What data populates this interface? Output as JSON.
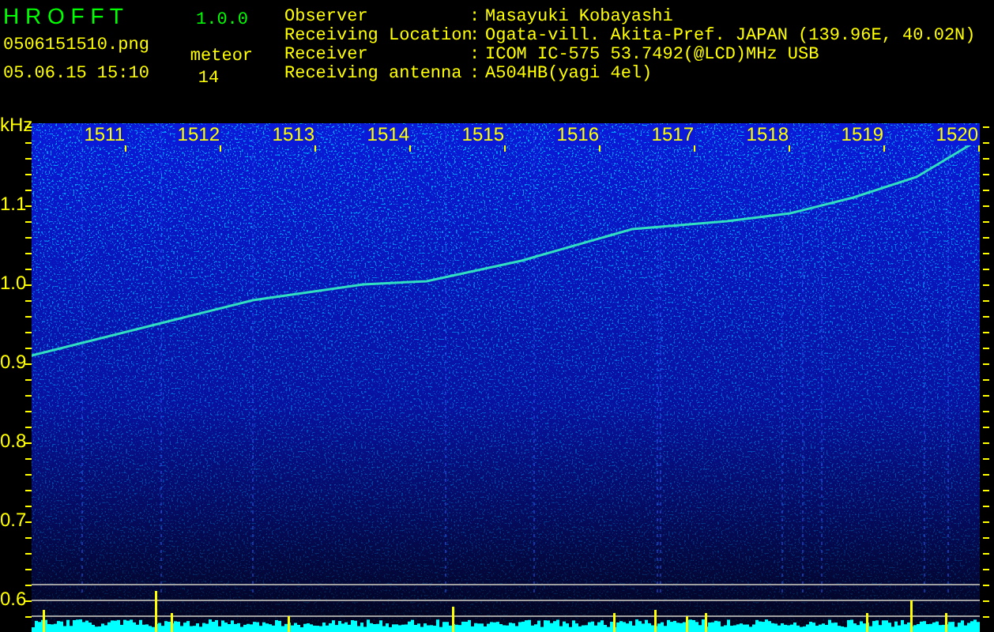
{
  "app": {
    "name": "H R O F F T",
    "version": "1.0.0",
    "file": "0506151510.png",
    "datetime": "05.06.15 15:10",
    "meteor_label": "meteor",
    "meteor_count": "14"
  },
  "info": [
    {
      "label": "Observer",
      "separator": ":",
      "value": "Masayuki Kobayashi"
    },
    {
      "label": "Receiving Location",
      "separator": ":",
      "value": "Ogata-vill. Akita-Pref. JAPAN (139.96E, 40.02N)"
    },
    {
      "label": "Receiver",
      "separator": ":",
      "value": "ICOM IC-575 53.7492(@LCD)MHz USB"
    },
    {
      "label": "Receiving antenna",
      "separator": ":",
      "value": "A504HB(yagi 4el)"
    }
  ],
  "spectrogram": {
    "unit": "kHz",
    "y_labels": [
      "1.1",
      "1.0",
      "0.9",
      "0.8",
      "0.7",
      "0.6"
    ],
    "time_labels": [
      "1511",
      "1512",
      "1513",
      "1514",
      "1515",
      "1516",
      "1517",
      "1518",
      "1519",
      "1520"
    ]
  }
}
